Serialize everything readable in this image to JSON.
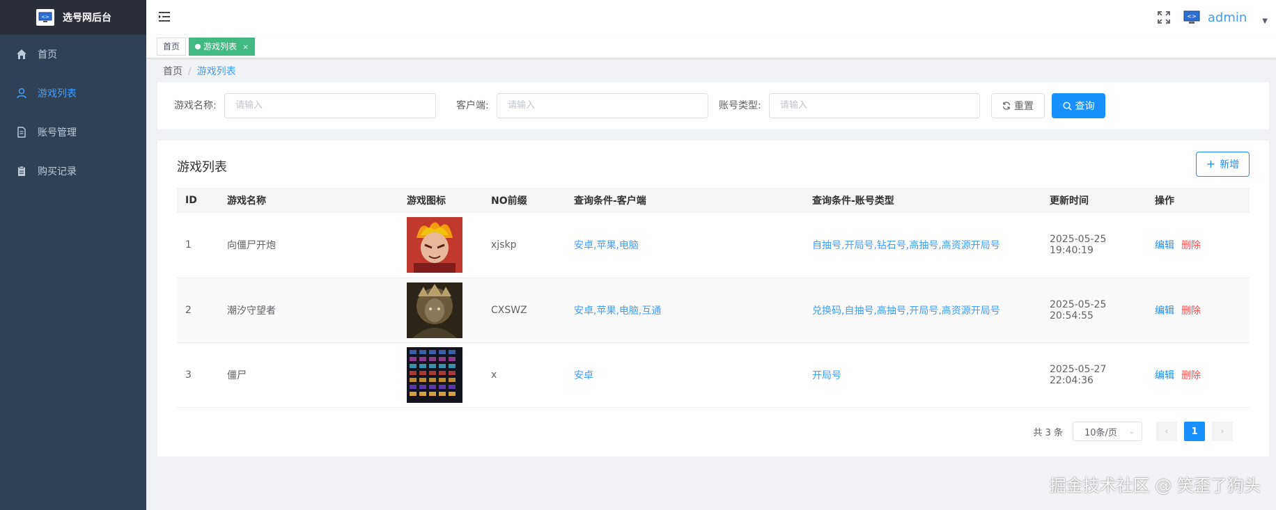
{
  "app": {
    "title": "选号网后台"
  },
  "sidebar": {
    "items": [
      {
        "label": "首页",
        "icon": "home-icon",
        "active": false
      },
      {
        "label": "游戏列表",
        "icon": "user-icon",
        "active": true
      },
      {
        "label": "账号管理",
        "icon": "document-icon",
        "active": false
      },
      {
        "label": "购买记录",
        "icon": "clipboard-icon",
        "active": false
      }
    ]
  },
  "header": {
    "username": "admin"
  },
  "tags": [
    {
      "label": "首页",
      "active": false
    },
    {
      "label": "游戏列表",
      "active": true,
      "close": "×"
    }
  ],
  "breadcrumb": {
    "home": "首页",
    "separator": "/",
    "current": "游戏列表"
  },
  "search": {
    "game_name_label": "游戏名称:",
    "client_label": "客户端:",
    "account_type_label": "账号类型:",
    "placeholder": "请输入",
    "reset_label": "重置",
    "query_label": "查询"
  },
  "table_card": {
    "title": "游戏列表",
    "add_label": "新增",
    "columns": [
      "ID",
      "游戏名称",
      "游戏图标",
      "NO前缀",
      "查询条件-客户端",
      "查询条件-账号类型",
      "更新时间",
      "操作"
    ],
    "rows": [
      {
        "id": "1",
        "name": "向僵尸开炮",
        "prefix": "xjskp",
        "clients": "安卓,苹果,电脑",
        "account_types": "自抽号,开局号,钻石号,高抽号,高资源开局号",
        "updated": "2025-05-25 19:40:19"
      },
      {
        "id": "2",
        "name": "潮汐守望者",
        "prefix": "CXSWZ",
        "clients": "安卓,苹果,电脑,互通",
        "account_types": "兑换码,自抽号,高抽号,开局号,高资源开局号",
        "updated": "2025-05-25 20:54:55"
      },
      {
        "id": "3",
        "name": "僵尸",
        "prefix": "x",
        "clients": "安卓",
        "account_types": "开局号",
        "updated": "2025-05-27 22:04:36"
      }
    ],
    "edit_label": "编辑",
    "delete_label": "删除"
  },
  "pagination": {
    "total_text": "共 3 条",
    "page_size": "10条/页",
    "current_page": "1"
  },
  "watermark": "掘金技术社区 @ 笑歪了狗头",
  "colors": {
    "sidebar": "#304156",
    "accent": "#409eff",
    "primary": "#1890ff",
    "tag_active": "#42b983",
    "danger": "#ff4d4f"
  }
}
